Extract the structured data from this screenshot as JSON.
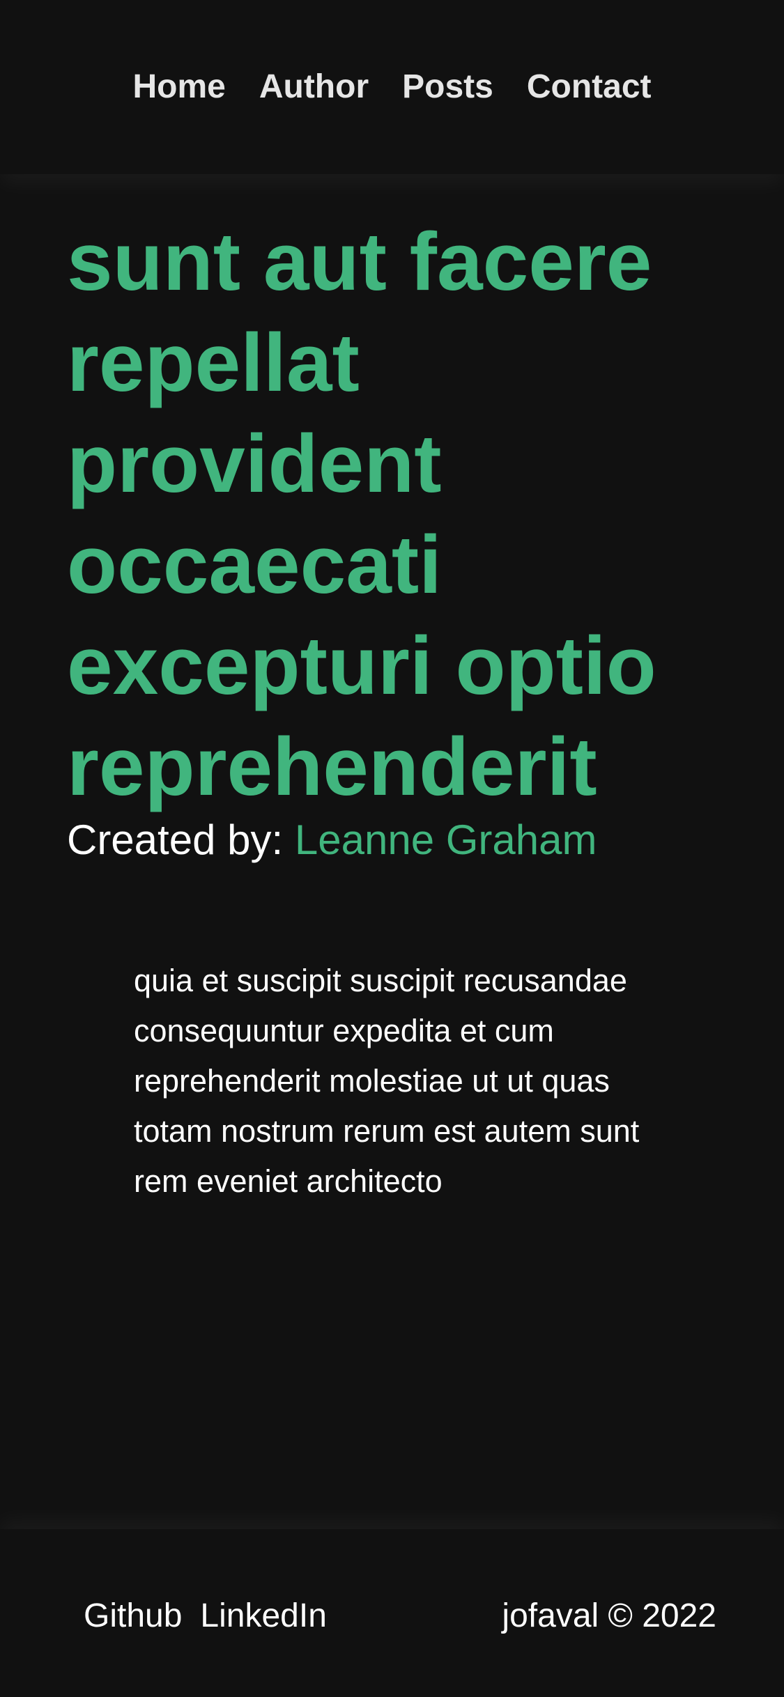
{
  "nav": {
    "items": [
      {
        "label": "Home"
      },
      {
        "label": "Author"
      },
      {
        "label": "Posts"
      },
      {
        "label": "Contact"
      }
    ]
  },
  "post": {
    "title": "sunt aut facere repellat provident occaecati excepturi optio reprehenderit",
    "byline_prefix": "Created by:",
    "author": "Leanne Graham",
    "body": "quia et suscipit suscipit recusandae consequuntur expedita et cum reprehenderit molestiae ut ut quas totam nostrum rerum est autem sunt rem eveniet architecto"
  },
  "footer": {
    "links": [
      {
        "label": "Github"
      },
      {
        "label": "LinkedIn"
      }
    ],
    "copyright": "jofaval © 2022"
  },
  "colors": {
    "background": "#111111",
    "accent": "#41b57e",
    "text": "#ffffff",
    "nav_text": "#e6e6e6"
  }
}
